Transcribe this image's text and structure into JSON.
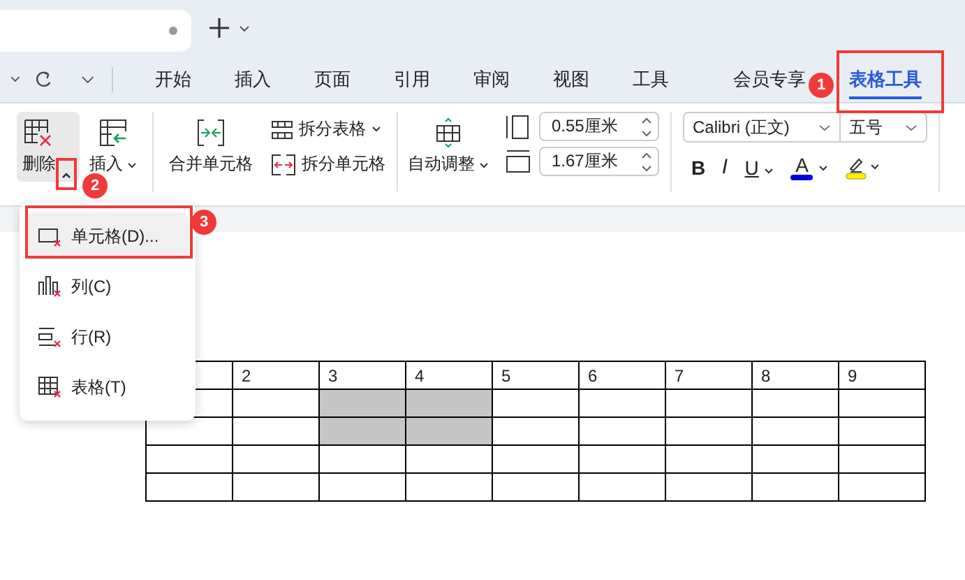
{
  "menu_tabs": [
    {
      "label": "开始",
      "selected": false
    },
    {
      "label": "插入",
      "selected": false
    },
    {
      "label": "页面",
      "selected": false
    },
    {
      "label": "引用",
      "selected": false
    },
    {
      "label": "审阅",
      "selected": false
    },
    {
      "label": "视图",
      "selected": false
    },
    {
      "label": "工具",
      "selected": false
    },
    {
      "label": "会员专享",
      "selected": false
    },
    {
      "label": "表格工具",
      "selected": true
    }
  ],
  "ribbon": {
    "delete_label": "删除",
    "insert_label": "插入",
    "merge_label": "合并单元格",
    "split_table_label": "拆分表格",
    "split_cells_label": "拆分单元格",
    "auto_fit_label": "自动调整",
    "row_height": "0.55厘米",
    "column_width": "1.67厘米",
    "font_name": "Calibri (正文)",
    "font_size": "五号",
    "format_buttons": [
      {
        "label": "B",
        "kind": "bold"
      },
      {
        "label": "I",
        "kind": "italic"
      },
      {
        "label": "U",
        "kind": "underline"
      },
      {
        "label": "A",
        "kind": "font-color"
      },
      {
        "kind": "highlight"
      }
    ]
  },
  "delete_menu": {
    "items": [
      {
        "label": "单元格(D)...",
        "kind": "cell",
        "selected": true
      },
      {
        "label": "列(C)",
        "kind": "column",
        "selected": false
      },
      {
        "label": "行(R)",
        "kind": "row",
        "selected": false
      },
      {
        "label": "表格(T)",
        "kind": "table",
        "selected": false
      }
    ]
  },
  "annotations": [
    {
      "number": "1"
    },
    {
      "number": "2"
    },
    {
      "number": "3"
    }
  ],
  "table": {
    "rows": [
      [
        {
          "selected": false
        },
        {
          "text": "2",
          "selected": false
        },
        {
          "text": "3",
          "selected": false
        },
        {
          "text": "4",
          "selected": false
        },
        {
          "text": "5",
          "selected": false
        },
        {
          "text": "6",
          "selected": false
        },
        {
          "text": "7",
          "selected": false
        },
        {
          "text": "8",
          "selected": false
        },
        {
          "text": "9",
          "selected": false
        }
      ],
      [
        {
          "selected": false
        },
        {
          "selected": false
        },
        {
          "selected": true
        },
        {
          "selected": true
        },
        {
          "selected": false
        },
        {
          "selected": false
        },
        {
          "selected": false
        },
        {
          "selected": false
        },
        {
          "selected": false
        }
      ],
      [
        {
          "selected": false
        },
        {
          "selected": false
        },
        {
          "selected": true
        },
        {
          "selected": true
        },
        {
          "selected": false
        },
        {
          "selected": false
        },
        {
          "selected": false
        },
        {
          "selected": false
        },
        {
          "selected": false
        }
      ],
      [
        {
          "selected": false
        },
        {
          "selected": false
        },
        {
          "selected": false
        },
        {
          "selected": false
        },
        {
          "selected": false
        },
        {
          "selected": false
        },
        {
          "selected": false
        },
        {
          "selected": false
        },
        {
          "selected": false
        }
      ],
      [
        {
          "selected": false
        },
        {
          "selected": false
        },
        {
          "selected": false
        },
        {
          "selected": false
        },
        {
          "selected": false
        },
        {
          "selected": false
        },
        {
          "selected": false
        },
        {
          "selected": false
        },
        {
          "selected": false
        }
      ]
    ]
  }
}
